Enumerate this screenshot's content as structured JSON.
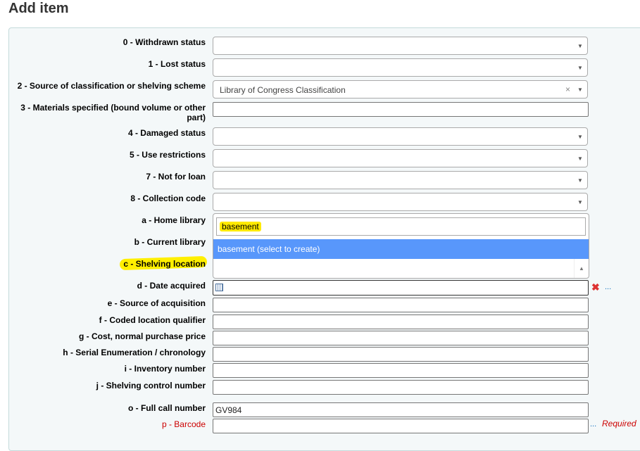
{
  "title": "Add item",
  "fields": {
    "f0": {
      "label": "0 - Withdrawn status",
      "value": ""
    },
    "f1": {
      "label": "1 - Lost status",
      "value": ""
    },
    "f2": {
      "label": "2 - Source of classification or shelving scheme",
      "value": "Library of Congress Classification",
      "clear": "×"
    },
    "f3": {
      "label": "3 - Materials specified (bound volume or other part)",
      "value": ""
    },
    "f4": {
      "label": "4 - Damaged status",
      "value": ""
    },
    "f5": {
      "label": "5 - Use restrictions",
      "value": ""
    },
    "f7": {
      "label": "7 - Not for loan",
      "value": ""
    },
    "f8": {
      "label": "8 - Collection code",
      "value": ""
    },
    "a": {
      "label": "a - Home library"
    },
    "b": {
      "label": "b - Current library"
    },
    "c": {
      "label": "c - Shelving location",
      "search": "basement",
      "option": "basement (select to create)"
    },
    "d": {
      "label": "d - Date acquired",
      "value": "",
      "clear": "✖",
      "more": "..."
    },
    "e": {
      "label": "e - Source of acquisition",
      "value": ""
    },
    "f": {
      "label": "f - Coded location qualifier",
      "value": ""
    },
    "g": {
      "label": "g - Cost, normal purchase price",
      "value": ""
    },
    "h": {
      "label": "h - Serial Enumeration / chronology",
      "value": ""
    },
    "i": {
      "label": "i - Inventory number",
      "value": ""
    },
    "j": {
      "label": "j - Shelving control number",
      "value": ""
    },
    "o": {
      "label": "o - Full call number",
      "value": "GV984"
    },
    "p": {
      "label": "p - Barcode",
      "value": "",
      "more": "...",
      "required": "Required"
    }
  },
  "colors": {
    "highlight": "#ffea00",
    "option_bg": "#5897fb",
    "required": "#cc0000"
  }
}
